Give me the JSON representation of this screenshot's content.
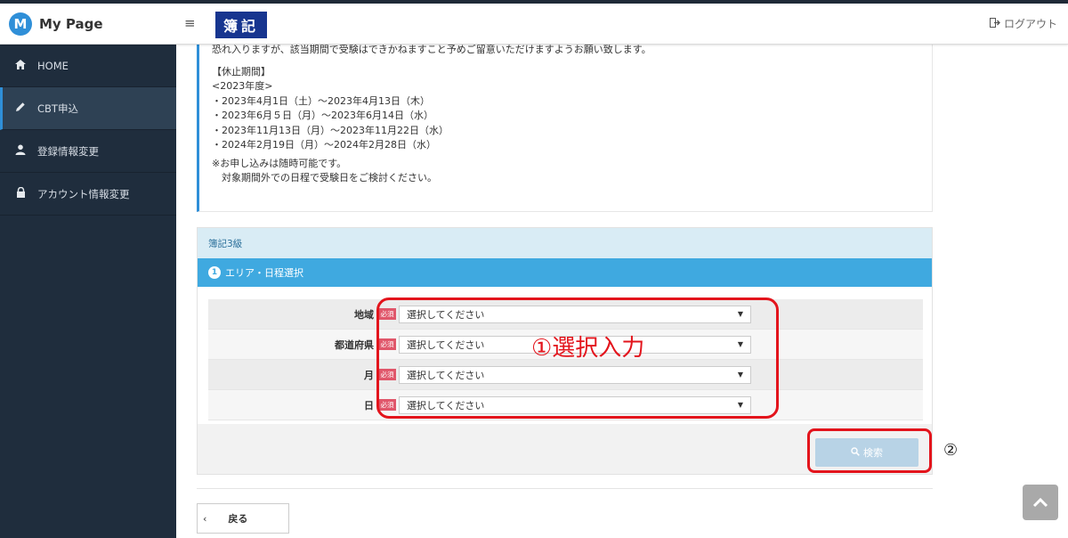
{
  "header": {
    "logo_letter": "M",
    "brand_title": "My Page",
    "menu_icon": "≡",
    "badge": "簿記",
    "logout_label": "ログアウト"
  },
  "sidebar": {
    "items": [
      {
        "label": "HOME",
        "icon": "home-icon"
      },
      {
        "label": "CBT申込",
        "icon": "pencil-icon",
        "active": true
      },
      {
        "label": "登録情報変更",
        "icon": "user-icon"
      },
      {
        "label": "アカウント情報変更",
        "icon": "lock-icon"
      }
    ]
  },
  "notice": {
    "intro": "恐れ入りますが、該当期間で受験はできかねますこと予めご留意いただけますようお願い致します。",
    "heading": "【休止期間】",
    "year": "<2023年度>",
    "periods": [
      "・2023年4月1日（土）～2023年4月13日（木）",
      "・2023年6月５日（月）～2023年6月14日（水）",
      "・2023年11月13日（月）～2023年11月22日（水）",
      "・2024年2月19日（月）～2024年2月28日（水）"
    ],
    "note1": "※お申し込みは随時可能です。",
    "note2": "　対象期間外での日程で受験日をご検討ください。"
  },
  "panel": {
    "title": "簿記3級",
    "step_number": "1",
    "step_label": "エリア・日程選択",
    "required_label": "必須",
    "fields": [
      {
        "label": "地域",
        "value": "選択してください"
      },
      {
        "label": "都道府県",
        "value": "選択してください"
      },
      {
        "label": "月",
        "value": "選択してください"
      },
      {
        "label": "日",
        "value": "選択してください"
      }
    ],
    "search_label": "検索"
  },
  "back_label": "戻る",
  "annotations": {
    "box1_text": "①選択入力",
    "box2_text": "②"
  },
  "colors": {
    "sidebar_bg": "#1f2d3d",
    "accent": "#2f8fd8",
    "badge_bg": "#17358f",
    "step_bar": "#3fa9e0",
    "required": "#e0566a",
    "annotation": "#e3141c"
  }
}
